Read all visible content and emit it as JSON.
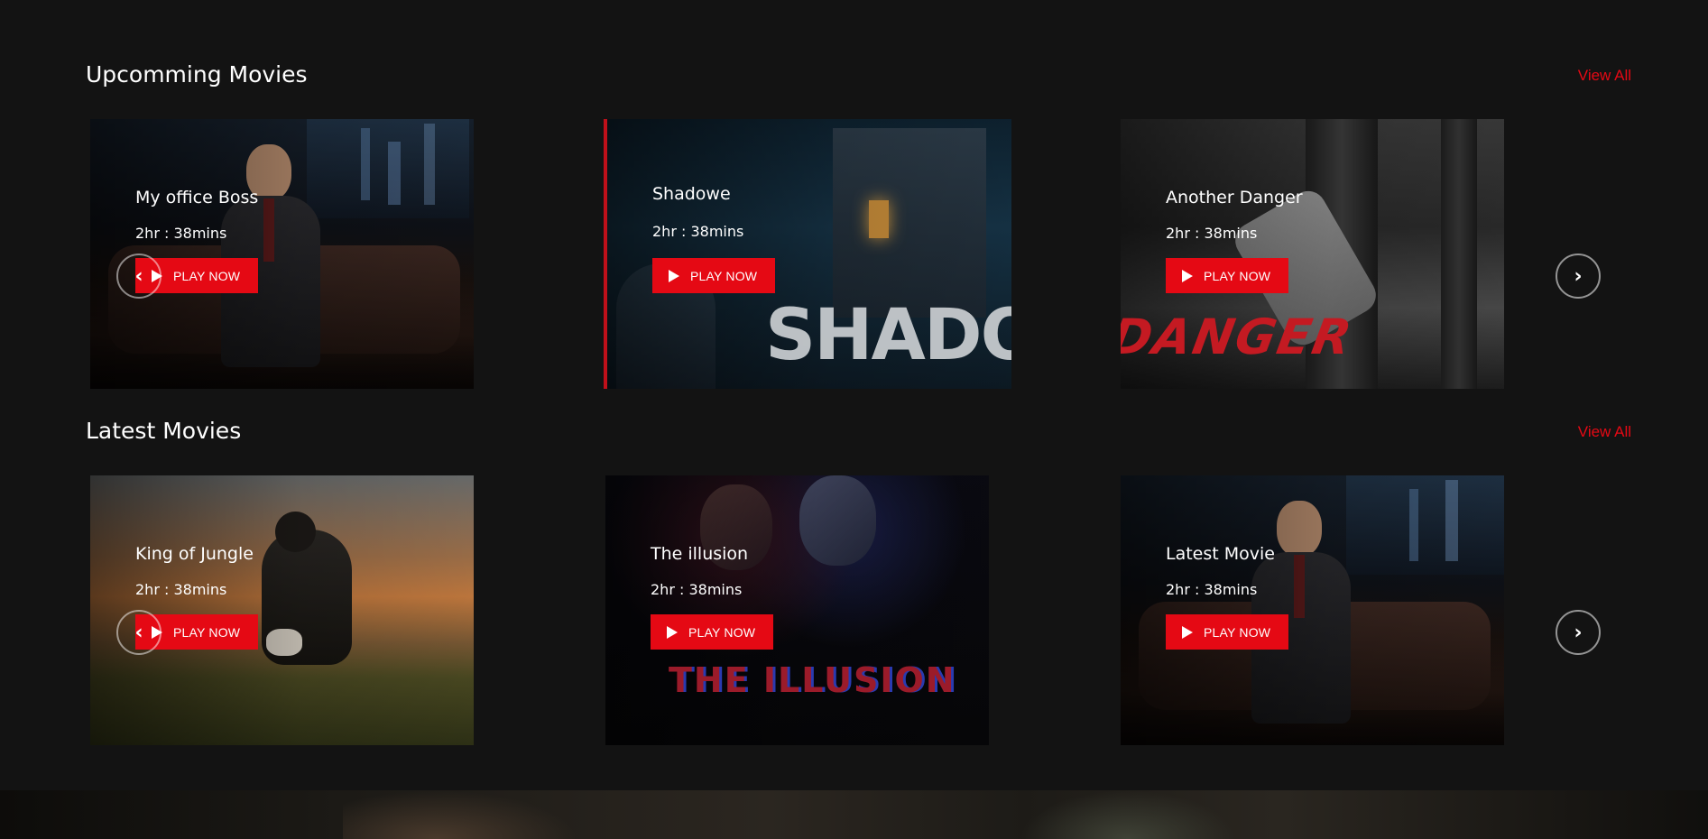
{
  "sections": [
    {
      "title": "Upcomming Movies",
      "view_all": "View All",
      "cards": [
        {
          "title": "My office Boss",
          "duration": "2hr : 38mins",
          "play_label": "PLAY NOW"
        },
        {
          "title": "Shadowe",
          "duration": "2hr : 38mins",
          "play_label": "PLAY NOW",
          "poster_text": "SHADOW"
        },
        {
          "title": "Another Danger",
          "duration": "2hr : 38mins",
          "play_label": "PLAY NOW",
          "poster_text": "DANGER"
        }
      ]
    },
    {
      "title": "Latest Movies",
      "view_all": "View All",
      "cards": [
        {
          "title": "King of Jungle",
          "duration": "2hr : 38mins",
          "play_label": "PLAY NOW"
        },
        {
          "title": "The illusion",
          "duration": "2hr : 38mins",
          "play_label": "PLAY NOW",
          "poster_text": "THE ILLUSION"
        },
        {
          "title": "Latest Movie",
          "duration": "2hr : 38mins",
          "play_label": "PLAY NOW"
        }
      ]
    }
  ],
  "icons": {
    "play": "play-icon",
    "prev": "chevron-left-icon",
    "next": "chevron-right-icon"
  },
  "colors": {
    "accent": "#e50914",
    "background": "#131313"
  }
}
